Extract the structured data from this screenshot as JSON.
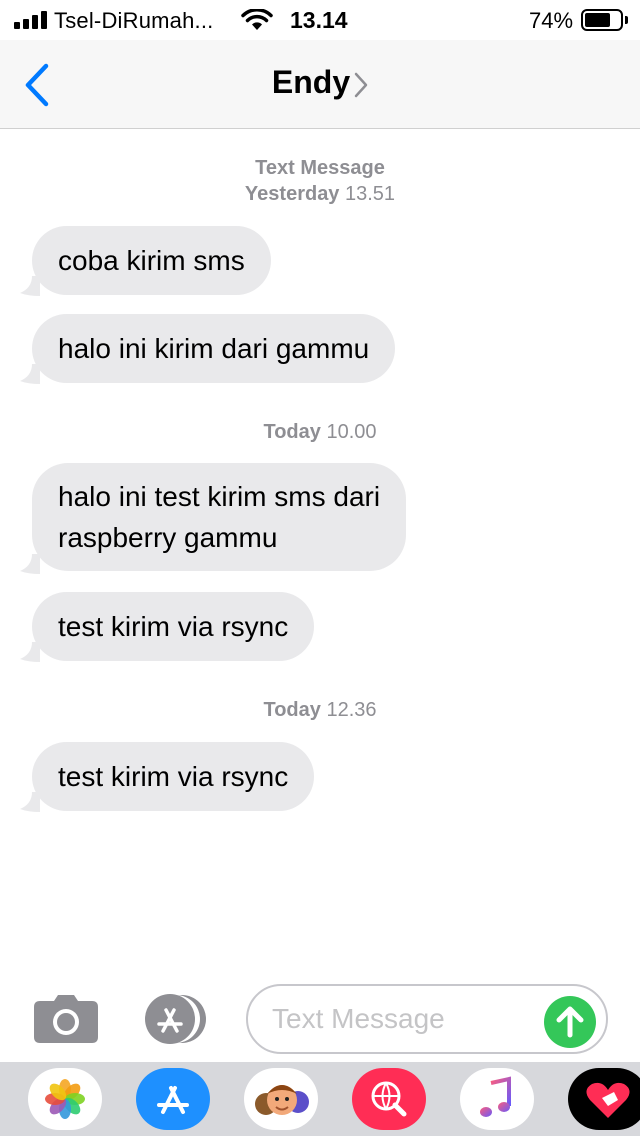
{
  "status_bar": {
    "carrier": "Tsel-DiRumah...",
    "time": "13.14",
    "battery_percent": "74%",
    "battery_level": 0.74
  },
  "nav": {
    "contact_name": "Endy"
  },
  "thread": {
    "stamp1": {
      "label": "Text Message",
      "day": "Yesterday",
      "time": "13.51"
    },
    "stamp2": {
      "day": "Today",
      "time": "10.00"
    },
    "stamp3": {
      "day": "Today",
      "time": "12.36"
    },
    "messages": [
      "coba kirim sms",
      "halo ini kirim dari gammu",
      "halo ini test kirim sms dari",
      "raspberry gammu",
      "test kirim via rsync",
      "test kirim via rsync"
    ]
  },
  "composer": {
    "placeholder": "Text Message"
  },
  "app_drawer": {
    "apps": [
      "photos-icon",
      "app-store-icon",
      "memoji-icon",
      "web-search-icon",
      "music-icon",
      "digital-touch-icon"
    ]
  },
  "colors": {
    "accent": "#007aff",
    "bubble_gray": "#e9e9eb",
    "send_green": "#34c759",
    "timestamp_gray": "#8e8e93"
  }
}
